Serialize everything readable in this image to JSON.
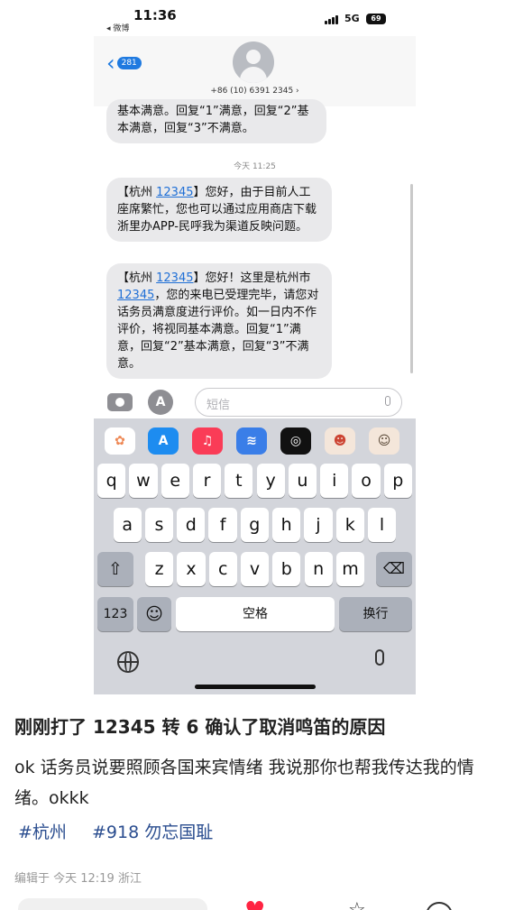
{
  "status": {
    "time": "11:36",
    "back_app": "◂ 微博",
    "network": "5G",
    "battery": "69"
  },
  "navbar": {
    "back_count": "281",
    "phone": "+86 (10) 6391 2345 ›"
  },
  "messages": {
    "partial": "基本满意。回复“1”满意，回复“2”基本满意，回复“3”不满意。",
    "timestamp": "今天 11:25",
    "b1": {
      "pre": "【杭州 ",
      "link": "12345",
      "post": "】您好，由于目前人工座席繁忙，您也可以通过应用商店下载浙里办APP-民呼我为渠道反映问题。"
    },
    "b2": {
      "pre": "【杭州 ",
      "link": "12345",
      "mid": "】您好！这里是杭州市",
      "link2": "12345",
      "post": "，您的来电已受理完毕，请您对话务员满意度进行评价。如一日内不作评价，将视同基本满意。回复“1”满意，回复“2”基本满意，回复“3”不满意。"
    }
  },
  "composer": {
    "placeholder": "短信",
    "app_button": "A"
  },
  "keyboard": {
    "row1": [
      "q",
      "w",
      "e",
      "r",
      "t",
      "y",
      "u",
      "i",
      "o",
      "p"
    ],
    "row2": [
      "a",
      "s",
      "d",
      "f",
      "g",
      "h",
      "j",
      "k",
      "l"
    ],
    "row3": [
      "z",
      "x",
      "c",
      "v",
      "b",
      "n",
      "m"
    ],
    "num": "123",
    "emoji": "☺",
    "space": "空格",
    "enter": "换行"
  },
  "post": {
    "title": "刚刚打了 12345 转 6 确认了取消鸣笛的原因",
    "body": "ok 话务员说要照顾各国来宾情绪 我说那你也帮我传达我的情绪。okkk",
    "tags": [
      "#杭州",
      "#918 勿忘国耻"
    ],
    "meta": "编辑于 今天 12:19 浙江"
  },
  "colors": {
    "accent": "#1f7ae0",
    "tag": "#2a4d8f",
    "like": "#ff2442"
  }
}
